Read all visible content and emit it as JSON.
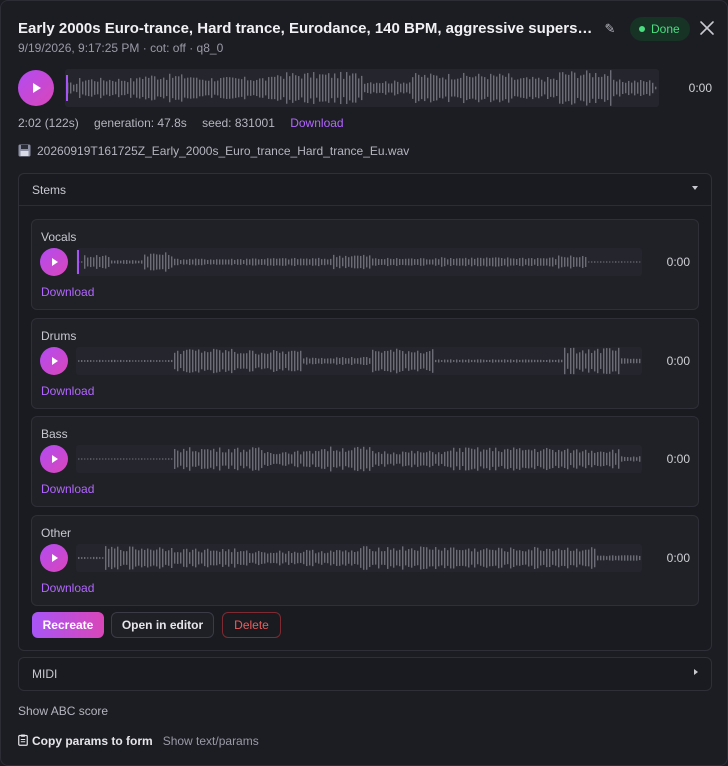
{
  "header": {
    "title": "Early 2000s Euro-trance, Hard trance, Eurodance, 140 BPM, aggressive supersaw s...",
    "subtitle": "9/19/2026, 9:17:25 PM · cot: off · q8_0",
    "status": "Done",
    "edit_icon": "pencil-icon",
    "close_icon": "close-icon"
  },
  "player": {
    "time": "0:00",
    "play_icon": "play-icon"
  },
  "meta": {
    "duration": "2:02 (122s)",
    "generation": "generation: 47.8s",
    "seed": "seed: 831001",
    "download_label": "Download"
  },
  "file": {
    "icon": "floppy-disk-icon",
    "name": "20260919T161725Z_Early_2000s_Euro_trance_Hard_trance_Eu.wav"
  },
  "stems": {
    "title": "Stems",
    "items": [
      {
        "name": "Vocals",
        "time": "0:00",
        "download_label": "Download"
      },
      {
        "name": "Drums",
        "time": "0:00",
        "download_label": "Download"
      },
      {
        "name": "Bass",
        "time": "0:00",
        "download_label": "Download"
      },
      {
        "name": "Other",
        "time": "0:00",
        "download_label": "Download"
      }
    ]
  },
  "actions": {
    "recreate": "Recreate",
    "open_editor": "Open in editor",
    "delete": "Delete"
  },
  "midi": {
    "title": "MIDI"
  },
  "abc_link": "Show ABC score",
  "footer": {
    "copy_label": "Copy params to form",
    "show_text": "Show text/params"
  },
  "colors": {
    "accent": "#b266ff",
    "play_gradient_start": "#b24bf3",
    "play_gradient_end": "#d946b8",
    "done_green": "#4ade80",
    "delete_red": "#ef5b5b",
    "background": "#1c1d23"
  }
}
